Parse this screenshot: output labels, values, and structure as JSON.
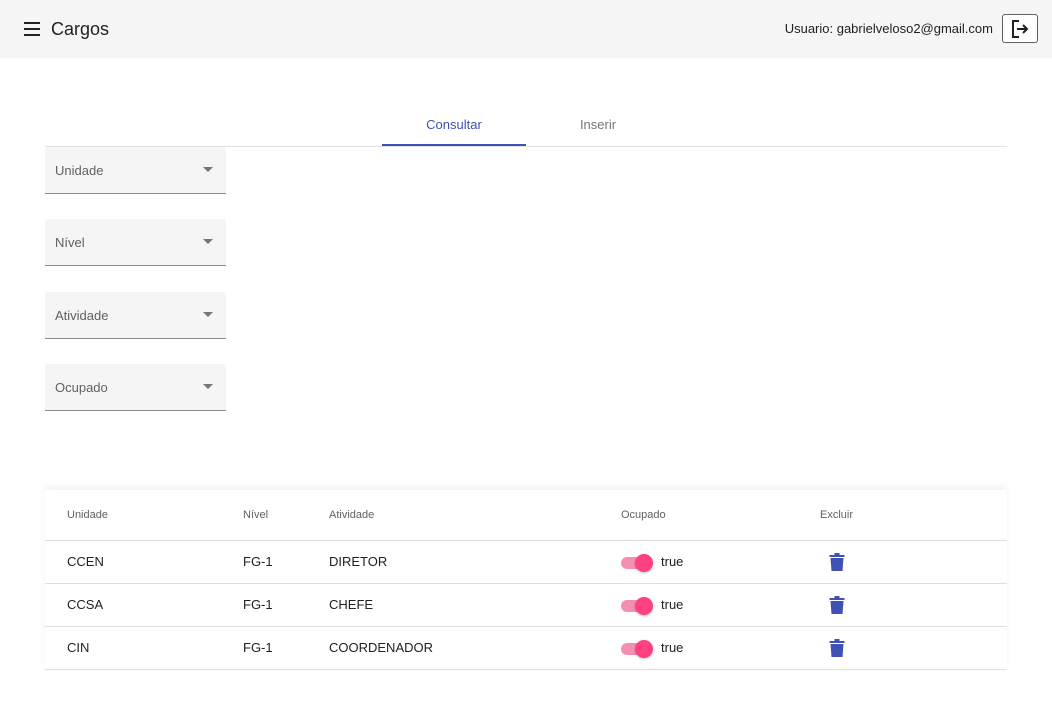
{
  "header": {
    "menu_icon": "hamburger-menu-icon",
    "title": "Cargos",
    "user_label": "Usuario: gabrielveloso2@gmail.com",
    "logout_icon": "logout-arrow-icon"
  },
  "tabs": [
    {
      "label": "Consultar",
      "active": true
    },
    {
      "label": "Inserir",
      "active": false
    }
  ],
  "accent_color": "#3f51b5",
  "toggle_color": "#ff4081",
  "filters": [
    {
      "label": "Unidade"
    },
    {
      "label": "Nível"
    },
    {
      "label": "Atividade"
    },
    {
      "label": "Ocupado"
    }
  ],
  "table": {
    "columns": [
      "Unidade",
      "Nível",
      "Atividade",
      "Ocupado",
      "Excluir"
    ],
    "rows": [
      {
        "unidade": "CCEN",
        "nivel": "FG-1",
        "atividade": "DIRETOR",
        "ocupado": "true",
        "ocupado_on": true
      },
      {
        "unidade": "CCSA",
        "nivel": "FG-1",
        "atividade": "CHEFE",
        "ocupado": "true",
        "ocupado_on": true
      },
      {
        "unidade": "CIN",
        "nivel": "FG-1",
        "atividade": "COORDENADOR",
        "ocupado": "true",
        "ocupado_on": true
      }
    ],
    "delete_icon": "trash-icon"
  }
}
